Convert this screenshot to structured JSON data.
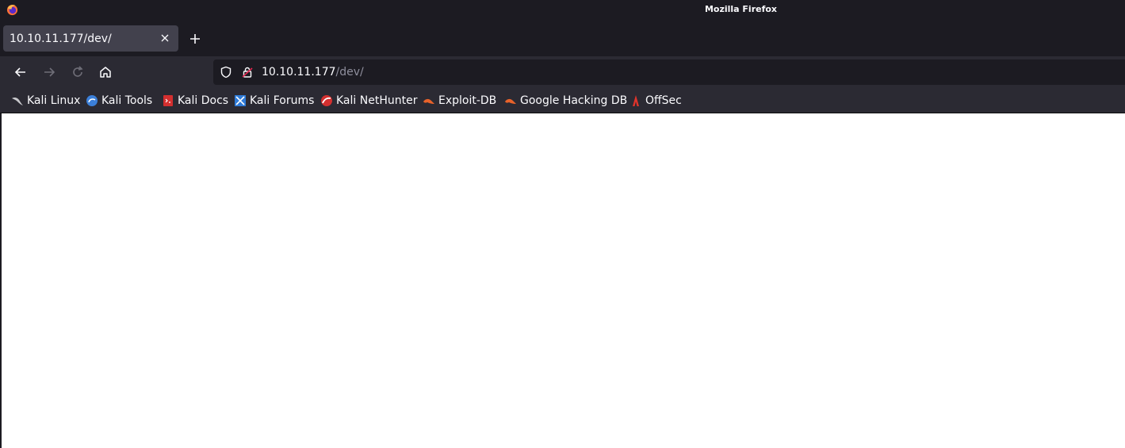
{
  "window": {
    "title": "Mozilla Firefox",
    "app_icon": "firefox-icon"
  },
  "tabs": [
    {
      "label": "10.10.11.177/dev/",
      "active": true,
      "close_icon": "close-icon"
    }
  ],
  "new_tab_icon": "plus-icon",
  "nav": {
    "back_icon": "back-arrow-icon",
    "forward_icon": "forward-arrow-icon",
    "reload_icon": "reload-icon",
    "home_icon": "home-icon"
  },
  "urlbar": {
    "host": "10.10.11.177",
    "path": "/dev/",
    "shield_icon": "tracking-protection-shield-icon",
    "lock_icon": "insecure-lock-icon"
  },
  "bookmarks": [
    {
      "label": "Kali Linux",
      "icon": "kali-dragon-icon"
    },
    {
      "label": "Kali Tools",
      "icon": "kali-tools-icon"
    },
    {
      "label": "Kali Docs",
      "icon": "kali-docs-icon"
    },
    {
      "label": "Kali Forums",
      "icon": "kali-forums-icon"
    },
    {
      "label": "Kali NetHunter",
      "icon": "kali-nethunter-icon"
    },
    {
      "label": "Exploit-DB",
      "icon": "exploit-db-icon"
    },
    {
      "label": "Google Hacking DB",
      "icon": "ghdb-icon"
    },
    {
      "label": "OffSec",
      "icon": "offsec-icon"
    }
  ],
  "colors": {
    "titlebar_bg": "#1c1b22",
    "toolbar_bg": "#2b2a33",
    "tab_active_bg": "#42414d",
    "text": "#fbfbfe",
    "url_path": "#8f8f9d",
    "page_bg": "#ffffff"
  }
}
